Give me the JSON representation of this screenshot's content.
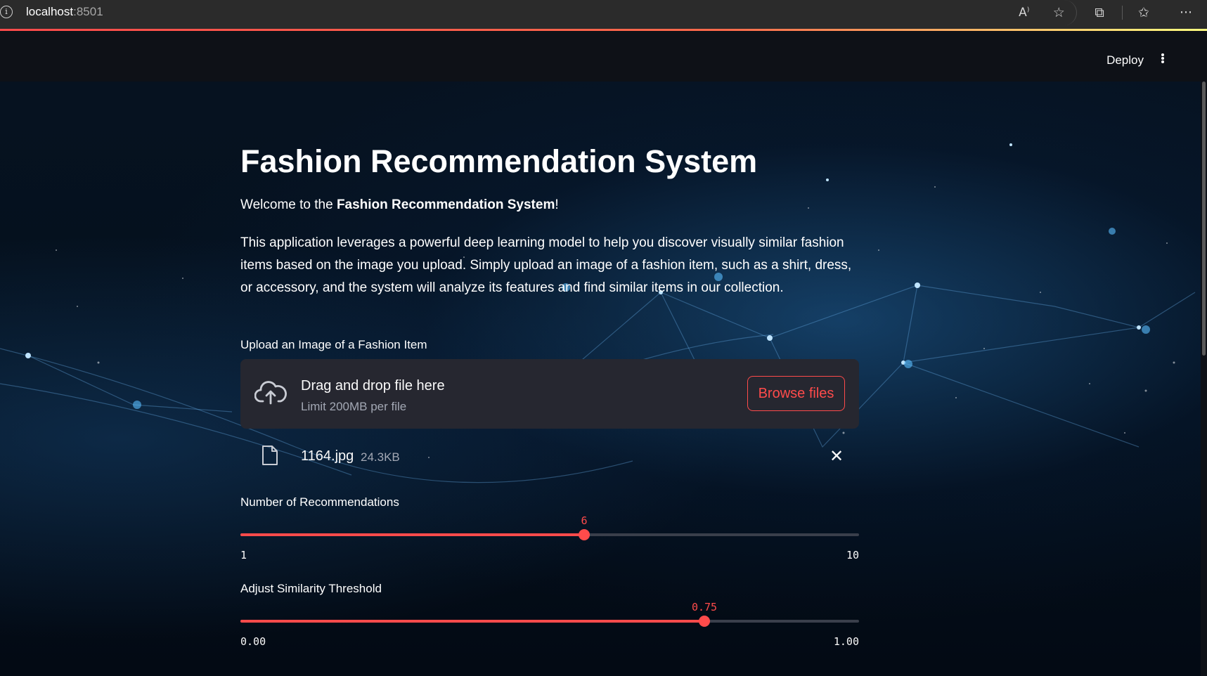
{
  "browser": {
    "url_host": "localhost",
    "url_port": ":8501",
    "icons": [
      "read-aloud-icon",
      "favorite-star-icon",
      "extensions-icon",
      "favorites-list-icon",
      "more-icon"
    ]
  },
  "header": {
    "deploy_label": "Deploy"
  },
  "main": {
    "title": "Fashion Recommendation System",
    "welcome_prefix": "Welcome to the ",
    "welcome_bold": "Fashion Recommendation System",
    "welcome_suffix": "!",
    "description": "This application leverages a powerful deep learning model to help you discover visually similar fashion items based on the image you upload. Simply upload an image of a fashion item, such as a shirt, dress, or accessory, and the system will analyze its features and find similar items in our collection.",
    "upload": {
      "label": "Upload an Image of a Fashion Item",
      "dropzone_title": "Drag and drop file here",
      "dropzone_limit": "Limit 200MB per file",
      "browse_label": "Browse files",
      "file_name": "1164.jpg",
      "file_size": "24.3KB"
    },
    "recommendations_slider": {
      "label": "Number of Recommendations",
      "value": "6",
      "min": "1",
      "max": "10",
      "fraction": 0.5556
    },
    "threshold_slider": {
      "label": "Adjust Similarity Threshold",
      "value": "0.75",
      "min": "0.00",
      "max": "1.00",
      "fraction": 0.75
    }
  },
  "colors": {
    "accent": "#ff4b4b",
    "header_bg": "#0e1117",
    "dropzone_bg": "#262730"
  }
}
